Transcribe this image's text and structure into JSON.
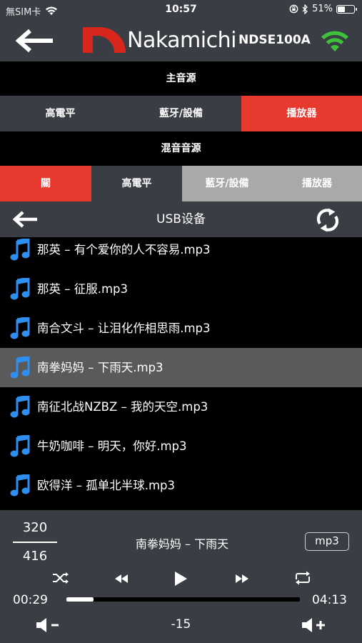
{
  "status_bar": {
    "carrier": "無SIM卡",
    "time": "10:57",
    "battery_text": "51%",
    "battery_level": 0.51
  },
  "header": {
    "brand": "Nakamichi",
    "device_name": "NDSE100A"
  },
  "main_source": {
    "title": "主音源",
    "options": [
      "高電平",
      "藍牙/設備",
      "播放器"
    ],
    "selected_index": 2
  },
  "mix_source": {
    "title": "混音音源",
    "options": [
      "關",
      "高電平",
      "藍牙/設備",
      "播放器"
    ],
    "selected_index": 0
  },
  "browser": {
    "title": "USB设备"
  },
  "files": [
    {
      "name": "那英 – 有个爱你的人不容易.mp3",
      "selected": false
    },
    {
      "name": "那英 – 征服.mp3",
      "selected": false
    },
    {
      "name": "南合文斗 – 让泪化作相思雨.mp3",
      "selected": false
    },
    {
      "name": "南拳妈妈 – 下雨天.mp3",
      "selected": true
    },
    {
      "name": "南征北战NZBZ – 我的天空.mp3",
      "selected": false
    },
    {
      "name": "牛奶咖啡 – 明天，你好.mp3",
      "selected": false
    },
    {
      "name": "欧得洋 – 孤单北半球.mp3",
      "selected": false
    }
  ],
  "player": {
    "track_number": "320",
    "track_total": "416",
    "now_playing": "南拳妈妈 – 下雨天",
    "format": "mp3",
    "elapsed": "00:29",
    "duration": "04:13",
    "progress": 0.115,
    "volume": "-15"
  },
  "colors": {
    "accent": "#e8392f",
    "panel": "#3a3d44",
    "note_icon": "#2f8ff0",
    "wifi": "#3ec13a"
  },
  "icons": {
    "back": "arrow-left-icon",
    "wifi": "wifi-icon",
    "refresh": "refresh-icon",
    "note": "music-note-icon",
    "shuffle": "shuffle-icon",
    "previous": "rewind-icon",
    "play": "play-icon",
    "next": "fast-forward-icon",
    "repeat": "repeat-icon",
    "volume_down": "volume-down-icon",
    "volume_up": "volume-up-icon"
  }
}
